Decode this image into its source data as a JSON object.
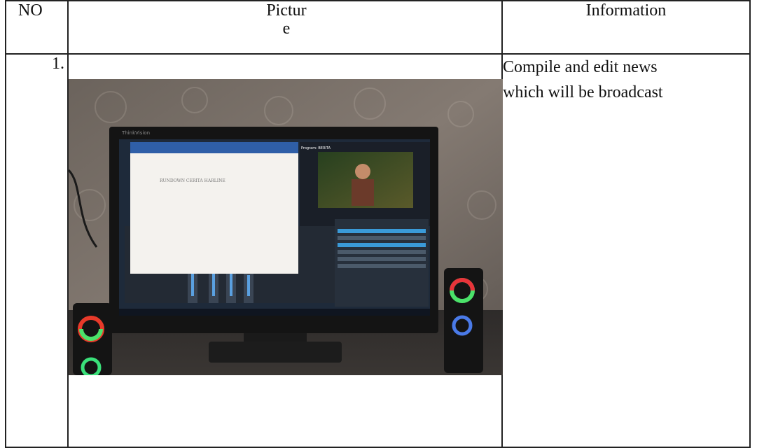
{
  "table": {
    "headers": {
      "no": "NO",
      "picture_line1": "Pictur",
      "picture_line2": "e",
      "information": "Information"
    },
    "rows": [
      {
        "number": "1.",
        "information_line1": "Compile and edit news",
        "information_line2": "which will be broadcast"
      }
    ]
  },
  "photo": {
    "monitor_brand": "ThinkVision",
    "document_title": "RUNDOWN CERITA HARLINE",
    "program_label": "Program: BERITA"
  }
}
